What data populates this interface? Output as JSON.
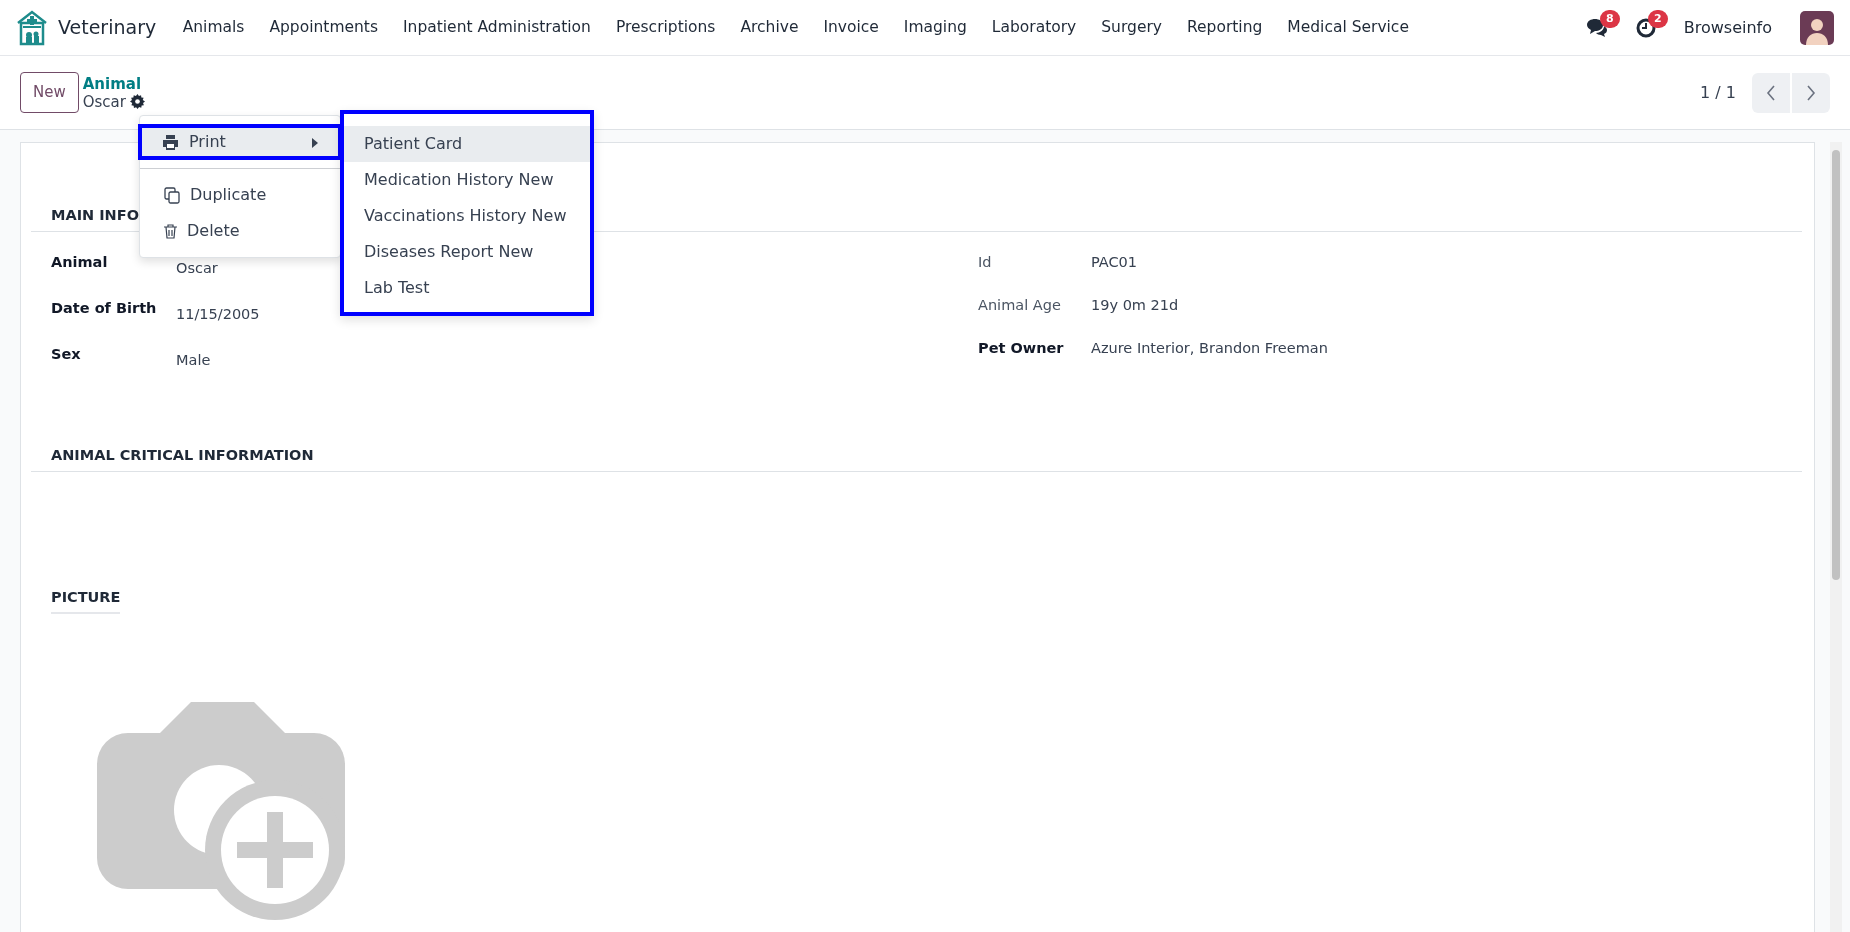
{
  "navbar": {
    "app_name": "Veterinary",
    "menu": [
      "Animals",
      "Appointments",
      "Inpatient Administration",
      "Prescriptions",
      "Archive",
      "Invoice",
      "Imaging",
      "Laboratory",
      "Surgery",
      "Reporting",
      "Medical Service"
    ],
    "messages_count": "8",
    "activities_count": "2",
    "user": "Browseinfo"
  },
  "control_panel": {
    "new_button": "New",
    "breadcrumb": "Animal",
    "record": "Oscar",
    "pager": "1 / 1"
  },
  "action_menu": {
    "groups": [
      [
        {
          "kind": "submenu",
          "label": "Print",
          "selected": true
        }
      ],
      [
        {
          "kind": "action",
          "label": "Duplicate",
          "selected": false
        },
        {
          "kind": "action",
          "label": "Delete",
          "selected": false
        }
      ]
    ]
  },
  "print_submenu": {
    "items": [
      {
        "label": "Patient Card",
        "selected": true
      },
      {
        "label": "Medication History New",
        "selected": false
      },
      {
        "label": "Vaccinations History New",
        "selected": false
      },
      {
        "label": "Diseases Report New",
        "selected": false
      },
      {
        "label": "Lab Test",
        "selected": false
      }
    ]
  },
  "form": {
    "sections": [
      {
        "kind": "fields",
        "title": "MAIN INFO",
        "left": [
          {
            "label": "Animal",
            "value": "Oscar"
          },
          {
            "label": "Date of Birth",
            "value": "11/15/2005"
          },
          {
            "label": "Sex",
            "value": "Male"
          }
        ],
        "right": [
          {
            "label": "Id",
            "value": "PAC01",
            "strong": false
          },
          {
            "label": "Animal Age",
            "value": "19y 0m 21d",
            "strong": false
          },
          {
            "label": "Pet Owner",
            "value": "Azure Interior, Brandon Freeman",
            "strong": true
          }
        ]
      },
      {
        "kind": "empty",
        "title": "ANIMAL CRITICAL INFORMATION"
      },
      {
        "kind": "image",
        "title": "PICTURE"
      }
    ]
  }
}
